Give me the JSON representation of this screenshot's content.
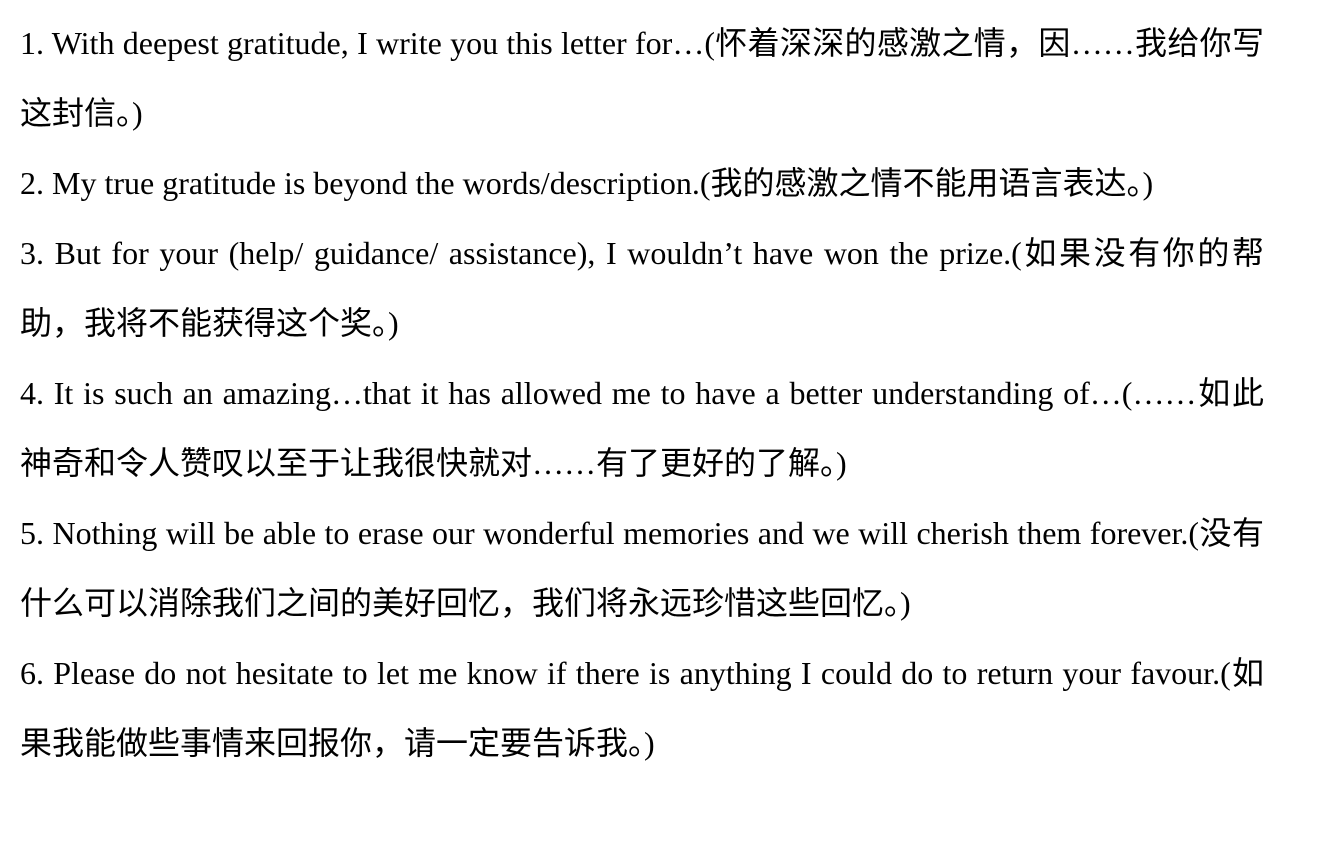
{
  "document": {
    "items": [
      "1. With deepest gratitude, I write you this letter for…(怀着深深的感激之情，因……我给你写这封信。)",
      "2. My true gratitude is beyond the words/description.(我的感激之情不能用语言表达。)",
      "3. But for your (help/ guidance/ assistance), I wouldn’t have won the prize.(如果没有你的帮助，我将不能获得这个奖。)",
      "4. It is such an amazing…that it has allowed me to have a better understanding of…(……如此神奇和令人赞叹以至于让我很快就对……有了更好的了解。)",
      "5. Nothing will be able to erase our wonderful memories and we will cherish them forever.(没有什么可以消除我们之间的美好回忆，我们将永远珍惜这些回忆。)",
      "6. Please do not hesitate to let me know if there is anything I could do to return your favour.(如果我能做些事情来回报你，请一定要告诉我。)"
    ]
  }
}
